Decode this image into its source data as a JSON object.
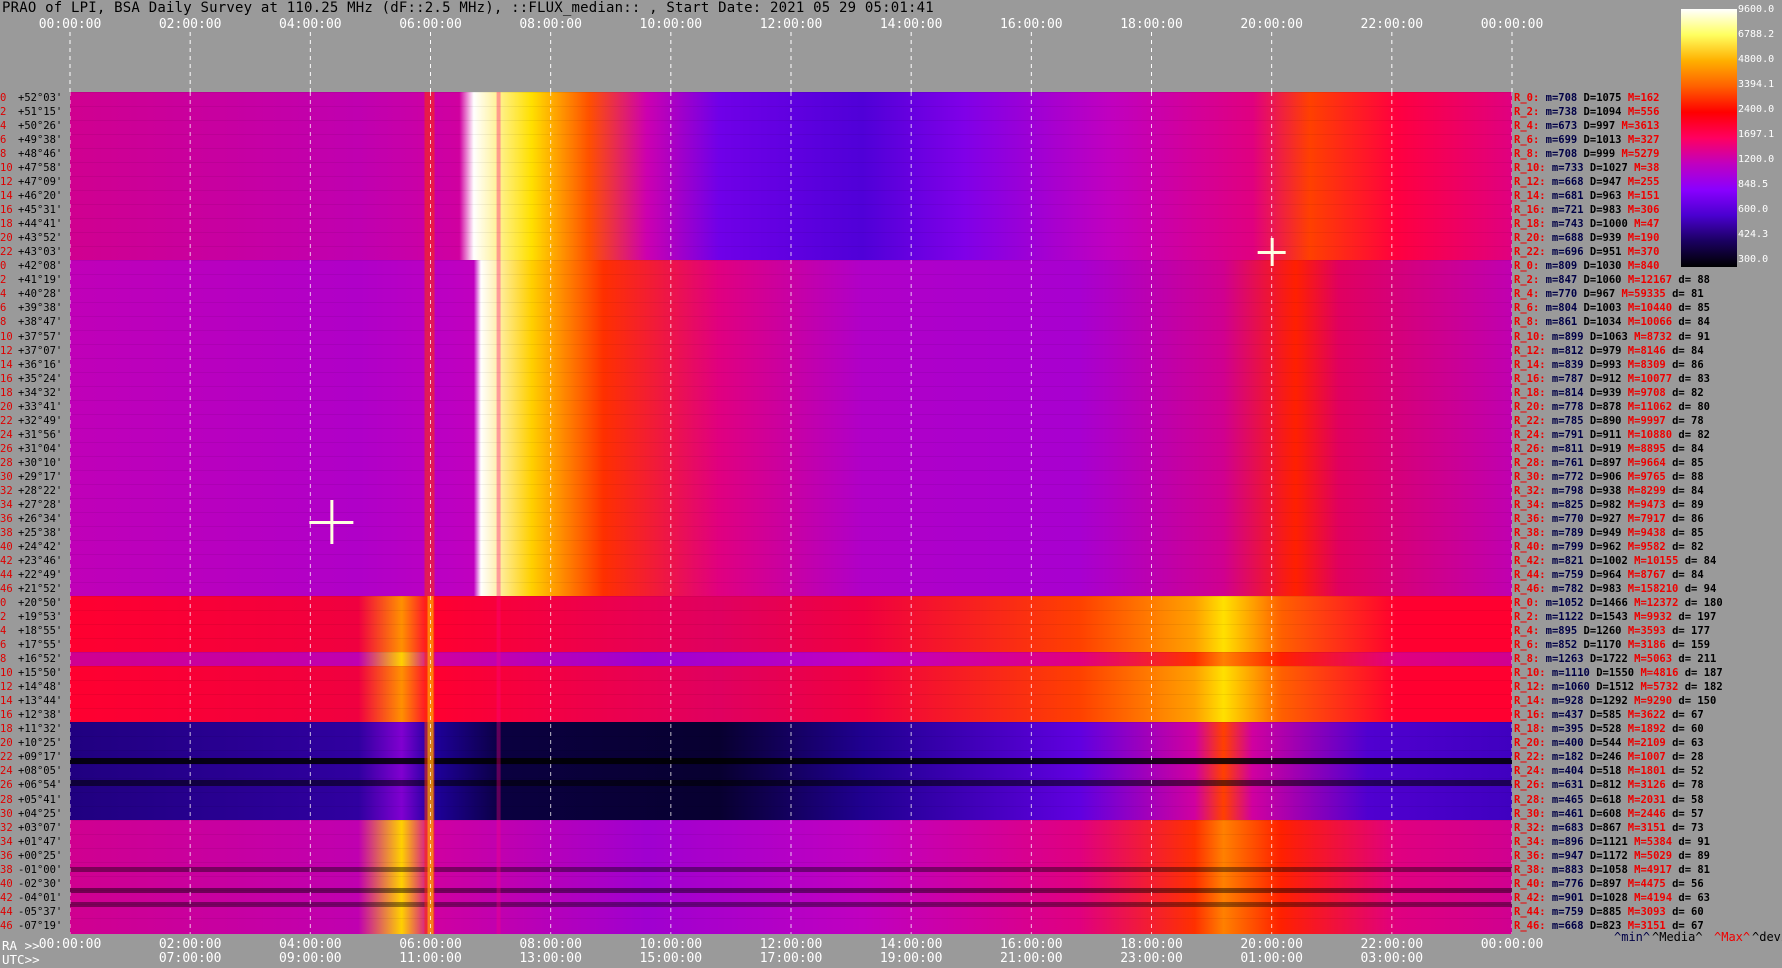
{
  "title": "PRAO of LPI, BSA Daily Survey at 110.25 MHz (dF::2.5 MHz), ::FLUX_median:: , Start Date: 2021 05 29 05:01:41",
  "chart_data": {
    "type": "heatmap",
    "x_top_ticks": [
      "00:00:00",
      "02:00:00",
      "04:00:00",
      "06:00:00",
      "08:00:00",
      "10:00:00",
      "12:00:00",
      "14:00:00",
      "16:00:00",
      "18:00:00",
      "20:00:00",
      "22:00:00",
      "00:00:00"
    ],
    "x_bottom_ra_ticks": [
      "00:00:00",
      "02:00:00",
      "04:00:00",
      "06:00:00",
      "08:00:00",
      "10:00:00",
      "12:00:00",
      "14:00:00",
      "16:00:00",
      "18:00:00",
      "20:00:00",
      "22:00:00",
      "00:00:00"
    ],
    "x_bottom_utc_ticks": [
      "07:00:00",
      "09:00:00",
      "11:00:00",
      "13:00:00",
      "15:00:00",
      "17:00:00",
      "19:00:00",
      "21:00:00",
      "23:00:00",
      "01:00:00",
      "03:00:00"
    ],
    "footer_ra": "RA >>",
    "footer_utc": "UTC>>",
    "colorbar": {
      "ticks": [
        "9600.0",
        "6788.2",
        "4800.0",
        "3394.1",
        "2400.0",
        "1697.1",
        "1200.0",
        "848.5",
        "600.0",
        "424.3",
        "300.0"
      ],
      "colormap": [
        "#000000",
        "#1a0060",
        "#4a00d0",
        "#8a00ff",
        "#c000c0",
        "#ff0060",
        "#ff0000",
        "#ff6000",
        "#ffb000",
        "#ffff60",
        "#ffffff"
      ]
    },
    "groups": [
      {
        "declinations": [
          "+52°03'",
          "+51°15'",
          "+50°26'",
          "+49°38'",
          "+48°46'",
          "+47°58'",
          "+47°09'",
          "+46°20'",
          "+45°31'",
          "+44°41'",
          "+43°52'",
          "+43°03'"
        ],
        "stats": [
          {
            "r": "R_0:",
            "m": "708",
            "d": "1075",
            "M": "162",
            "dev": ""
          },
          {
            "r": "R_2:",
            "m": "738",
            "d": "1094",
            "M": "556",
            "dev": ""
          },
          {
            "r": "R_4:",
            "m": "673",
            "d": "997",
            "M": "3613",
            "dev": ""
          },
          {
            "r": "R_6:",
            "m": "699",
            "d": "1013",
            "M": "327",
            "dev": ""
          },
          {
            "r": "R_8:",
            "m": "708",
            "d": "999",
            "M": "5279",
            "dev": ""
          },
          {
            "r": "R_10:",
            "m": "733",
            "d": "1027",
            "M": "38",
            "dev": ""
          },
          {
            "r": "R_12:",
            "m": "668",
            "d": "947",
            "M": "255",
            "dev": ""
          },
          {
            "r": "R_14:",
            "m": "681",
            "d": "963",
            "M": "151",
            "dev": ""
          },
          {
            "r": "R_16:",
            "m": "721",
            "d": "983",
            "M": "306",
            "dev": ""
          },
          {
            "r": "R_18:",
            "m": "743",
            "d": "1000",
            "M": "47",
            "dev": ""
          },
          {
            "r": "R_20:",
            "m": "688",
            "d": "939",
            "M": "190",
            "dev": ""
          },
          {
            "r": "R_22:",
            "m": "696",
            "d": "951",
            "M": "370",
            "dev": ""
          }
        ]
      },
      {
        "declinations": [
          "+42°08'",
          "+41°19'",
          "+40°28'",
          "+39°38'",
          "+38°47'",
          "+37°57'",
          "+37°07'",
          "+36°16'",
          "+35°24'",
          "+34°32'",
          "+33°41'",
          "+32°49'",
          "+31°56'",
          "+31°04'",
          "+30°10'",
          "+29°17'",
          "+28°22'",
          "+27°28'",
          "+26°34'",
          "+25°38'",
          "+24°42'",
          "+23°46'",
          "+22°49'",
          "+21°52'"
        ],
        "stats": [
          {
            "r": "R_0:",
            "m": "809",
            "d": "1030",
            "M": "840",
            "dev": ""
          },
          {
            "r": "R_2:",
            "m": "847",
            "d": "1060",
            "M": "12167",
            "dev": "88"
          },
          {
            "r": "R_4:",
            "m": "770",
            "d": "967",
            "M": "59335",
            "dev": "81"
          },
          {
            "r": "R_6:",
            "m": "804",
            "d": "1003",
            "M": "10440",
            "dev": "85"
          },
          {
            "r": "R_8:",
            "m": "861",
            "d": "1034",
            "M": "10066",
            "dev": "84"
          },
          {
            "r": "R_10:",
            "m": "899",
            "d": "1063",
            "M": "8732",
            "dev": "91"
          },
          {
            "r": "R_12:",
            "m": "812",
            "d": "979",
            "M": "8146",
            "dev": "84"
          },
          {
            "r": "R_14:",
            "m": "839",
            "d": "993",
            "M": "8309",
            "dev": "86"
          },
          {
            "r": "R_16:",
            "m": "787",
            "d": "912",
            "M": "10077",
            "dev": "83"
          },
          {
            "r": "R_18:",
            "m": "814",
            "d": "939",
            "M": "9708",
            "dev": "82"
          },
          {
            "r": "R_20:",
            "m": "778",
            "d": "878",
            "M": "11062",
            "dev": "80"
          },
          {
            "r": "R_22:",
            "m": "785",
            "d": "890",
            "M": "9997",
            "dev": "78"
          },
          {
            "r": "R_24:",
            "m": "791",
            "d": "911",
            "M": "10880",
            "dev": "82"
          },
          {
            "r": "R_26:",
            "m": "811",
            "d": "919",
            "M": "8895",
            "dev": "84"
          },
          {
            "r": "R_28:",
            "m": "761",
            "d": "897",
            "M": "9664",
            "dev": "85"
          },
          {
            "r": "R_30:",
            "m": "772",
            "d": "906",
            "M": "9765",
            "dev": "88"
          },
          {
            "r": "R_32:",
            "m": "798",
            "d": "938",
            "M": "8299",
            "dev": "84"
          },
          {
            "r": "R_34:",
            "m": "825",
            "d": "982",
            "M": "9473",
            "dev": "89"
          },
          {
            "r": "R_36:",
            "m": "770",
            "d": "927",
            "M": "7917",
            "dev": "86"
          },
          {
            "r": "R_38:",
            "m": "789",
            "d": "949",
            "M": "9438",
            "dev": "85"
          },
          {
            "r": "R_40:",
            "m": "799",
            "d": "962",
            "M": "9582",
            "dev": "82"
          },
          {
            "r": "R_42:",
            "m": "821",
            "d": "1002",
            "M": "10155",
            "dev": "84"
          },
          {
            "r": "R_44:",
            "m": "759",
            "d": "964",
            "M": "8767",
            "dev": "84"
          },
          {
            "r": "R_46:",
            "m": "782",
            "d": "983",
            "M": "158210",
            "dev": "94"
          }
        ]
      },
      {
        "declinations": [
          "+20°50'",
          "+19°53'",
          "+18°55'",
          "+17°55'",
          "+16°52'",
          "+15°50'",
          "+14°48'",
          "+13°44'",
          "+12°38'",
          "+11°32'",
          "+10°25'",
          "+09°17'",
          "+08°05'",
          "+06°54'",
          "+05°41'",
          "+04°25'",
          "+03°07'",
          "+01°47'",
          "+00°25'",
          "-01°00'",
          "-02°30'",
          "-04°01'",
          "-05°37'",
          "-07°19'"
        ],
        "stats": [
          {
            "r": "R_0:",
            "m": "1052",
            "d": "1466",
            "M": "12372",
            "dev": "180"
          },
          {
            "r": "R_2:",
            "m": "1122",
            "d": "1543",
            "M": "9932",
            "dev": "197"
          },
          {
            "r": "R_4:",
            "m": "895",
            "d": "1260",
            "M": "3593",
            "dev": "177"
          },
          {
            "r": "R_6:",
            "m": "852",
            "d": "1170",
            "M": "3186",
            "dev": "159"
          },
          {
            "r": "R_8:",
            "m": "1263",
            "d": "1722",
            "M": "5063",
            "dev": "211"
          },
          {
            "r": "R_10:",
            "m": "1110",
            "d": "1550",
            "M": "4816",
            "dev": "187"
          },
          {
            "r": "R_12:",
            "m": "1060",
            "d": "1512",
            "M": "5732",
            "dev": "182"
          },
          {
            "r": "R_14:",
            "m": "928",
            "d": "1292",
            "M": "9290",
            "dev": "150"
          },
          {
            "r": "R_16:",
            "m": "437",
            "d": "585",
            "M": "3622",
            "dev": "67"
          },
          {
            "r": "R_18:",
            "m": "395",
            "d": "528",
            "M": "1892",
            "dev": "60"
          },
          {
            "r": "R_20:",
            "m": "400",
            "d": "544",
            "M": "2109",
            "dev": "63"
          },
          {
            "r": "R_22:",
            "m": "182",
            "d": "246",
            "M": "1007",
            "dev": "28"
          },
          {
            "r": "R_24:",
            "m": "404",
            "d": "518",
            "M": "1801",
            "dev": "52"
          },
          {
            "r": "R_26:",
            "m": "631",
            "d": "812",
            "M": "3126",
            "dev": "78"
          },
          {
            "r": "R_28:",
            "m": "465",
            "d": "618",
            "M": "2031",
            "dev": "58"
          },
          {
            "r": "R_30:",
            "m": "461",
            "d": "608",
            "M": "2446",
            "dev": "57"
          },
          {
            "r": "R_32:",
            "m": "683",
            "d": "867",
            "M": "3151",
            "dev": "73"
          },
          {
            "r": "R_34:",
            "m": "896",
            "d": "1121",
            "M": "5384",
            "dev": "91"
          },
          {
            "r": "R_36:",
            "m": "947",
            "d": "1172",
            "M": "5029",
            "dev": "89"
          },
          {
            "r": "R_38:",
            "m": "883",
            "d": "1058",
            "M": "4917",
            "dev": "81"
          },
          {
            "r": "R_40:",
            "m": "776",
            "d": "897",
            "M": "4475",
            "dev": "56"
          },
          {
            "r": "R_42:",
            "m": "901",
            "d": "1028",
            "M": "4194",
            "dev": "63"
          },
          {
            "r": "R_44:",
            "m": "759",
            "d": "885",
            "M": "3093",
            "dev": "60"
          },
          {
            "r": "R_46:",
            "m": "668",
            "d": "823",
            "M": "3151",
            "dev": "67"
          }
        ]
      }
    ],
    "legend": {
      "min": "^min^",
      "media": "^Media^",
      "max": "^Max^",
      "devia": "^devia"
    }
  }
}
